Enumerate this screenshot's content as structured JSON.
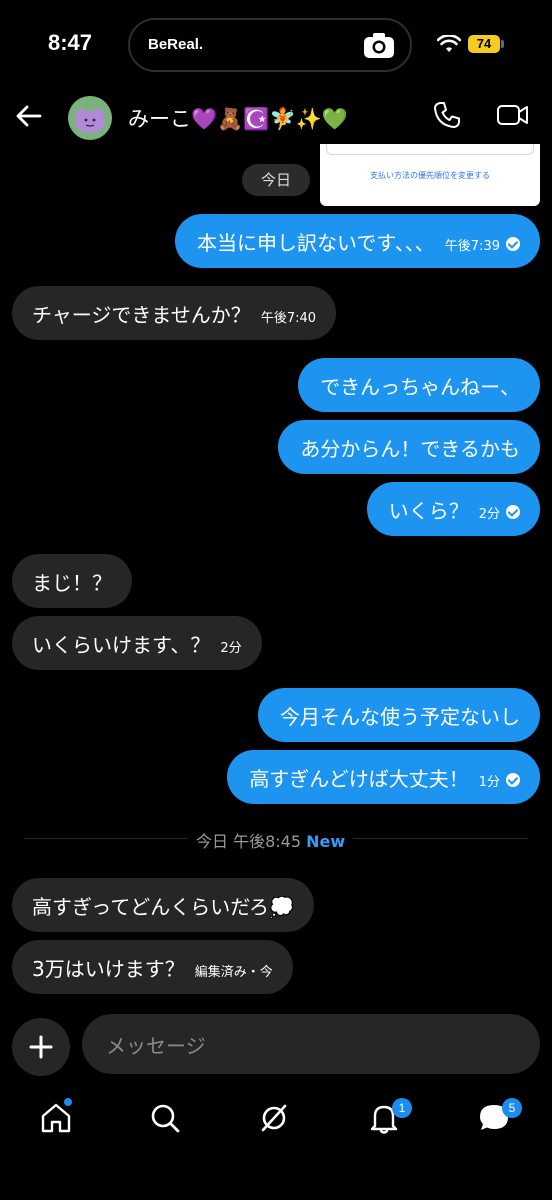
{
  "status": {
    "time": "8:47",
    "island_app": "BeReal.",
    "battery": "74"
  },
  "header": {
    "title": "みーこ💜🧸☪️🧚✨💚"
  },
  "date_pill": "今日",
  "preview": {
    "link_text": "支払い方法の優先順位を変更する"
  },
  "messages": [
    {
      "dir": "out",
      "text": "本当に申し訳ないです、、、",
      "meta": "午後7:39",
      "read": true
    },
    {
      "dir": "in",
      "text": "チャージできませんか？",
      "meta": "午後7:40"
    },
    {
      "dir": "out",
      "text": "できんっちゃんねー、"
    },
    {
      "dir": "out",
      "text": "あ分からん！できるかも"
    },
    {
      "dir": "out",
      "text": "いくら？",
      "meta": "2分",
      "read": true
    },
    {
      "dir": "in",
      "text": "まじ！？"
    },
    {
      "dir": "in",
      "text": "いくらいけます、？",
      "meta": "2分"
    },
    {
      "dir": "out",
      "text": "今月そんな使う予定ないし"
    },
    {
      "dir": "out",
      "text": "高すぎんどけば大丈夫！",
      "meta": "1分",
      "read": true
    },
    {
      "dir": "in",
      "text": "高すぎってどんくらいだろ💭"
    },
    {
      "dir": "in",
      "text": "3万はいけます？",
      "meta": "編集済み・今"
    }
  ],
  "divider": {
    "label": "今日 午後8:45",
    "new_label": "New"
  },
  "composer": {
    "placeholder": "メッセージ"
  },
  "tabs": {
    "notifications_badge": "1",
    "messages_badge": "5"
  },
  "colors": {
    "accent": "#1d95f0",
    "incoming": "#262626",
    "background": "#000000"
  }
}
